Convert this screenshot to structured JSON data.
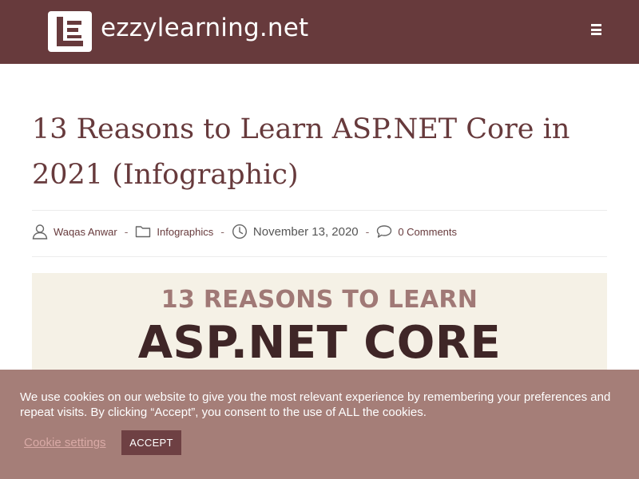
{
  "header": {
    "site_name": "ezzylearning.net",
    "logo_icon": "ezzylearning-logo-icon",
    "menu_icon": "hamburger-menu-icon",
    "background_color": "#673a3c"
  },
  "post": {
    "title": "13 Reasons to Learn ASP.NET Core in 2021 (Infographic)",
    "meta": {
      "author": "Waqas Anwar",
      "category": "Infographics",
      "date": "November 13, 2020",
      "comments": "0 Comments",
      "separator": "-"
    },
    "featured_image": {
      "line1": "13 REASONS TO LEARN",
      "line2": "ASP.NET CORE"
    }
  },
  "cookie_banner": {
    "message": "We use cookies on our website to give you the most relevant experience by remembering your preferences and repeat visits. By clicking “Accept”, you consent to the use of ALL the cookies.",
    "settings_label": "Cookie settings",
    "accept_label": "ACCEPT",
    "background_color": "#a57e78"
  }
}
